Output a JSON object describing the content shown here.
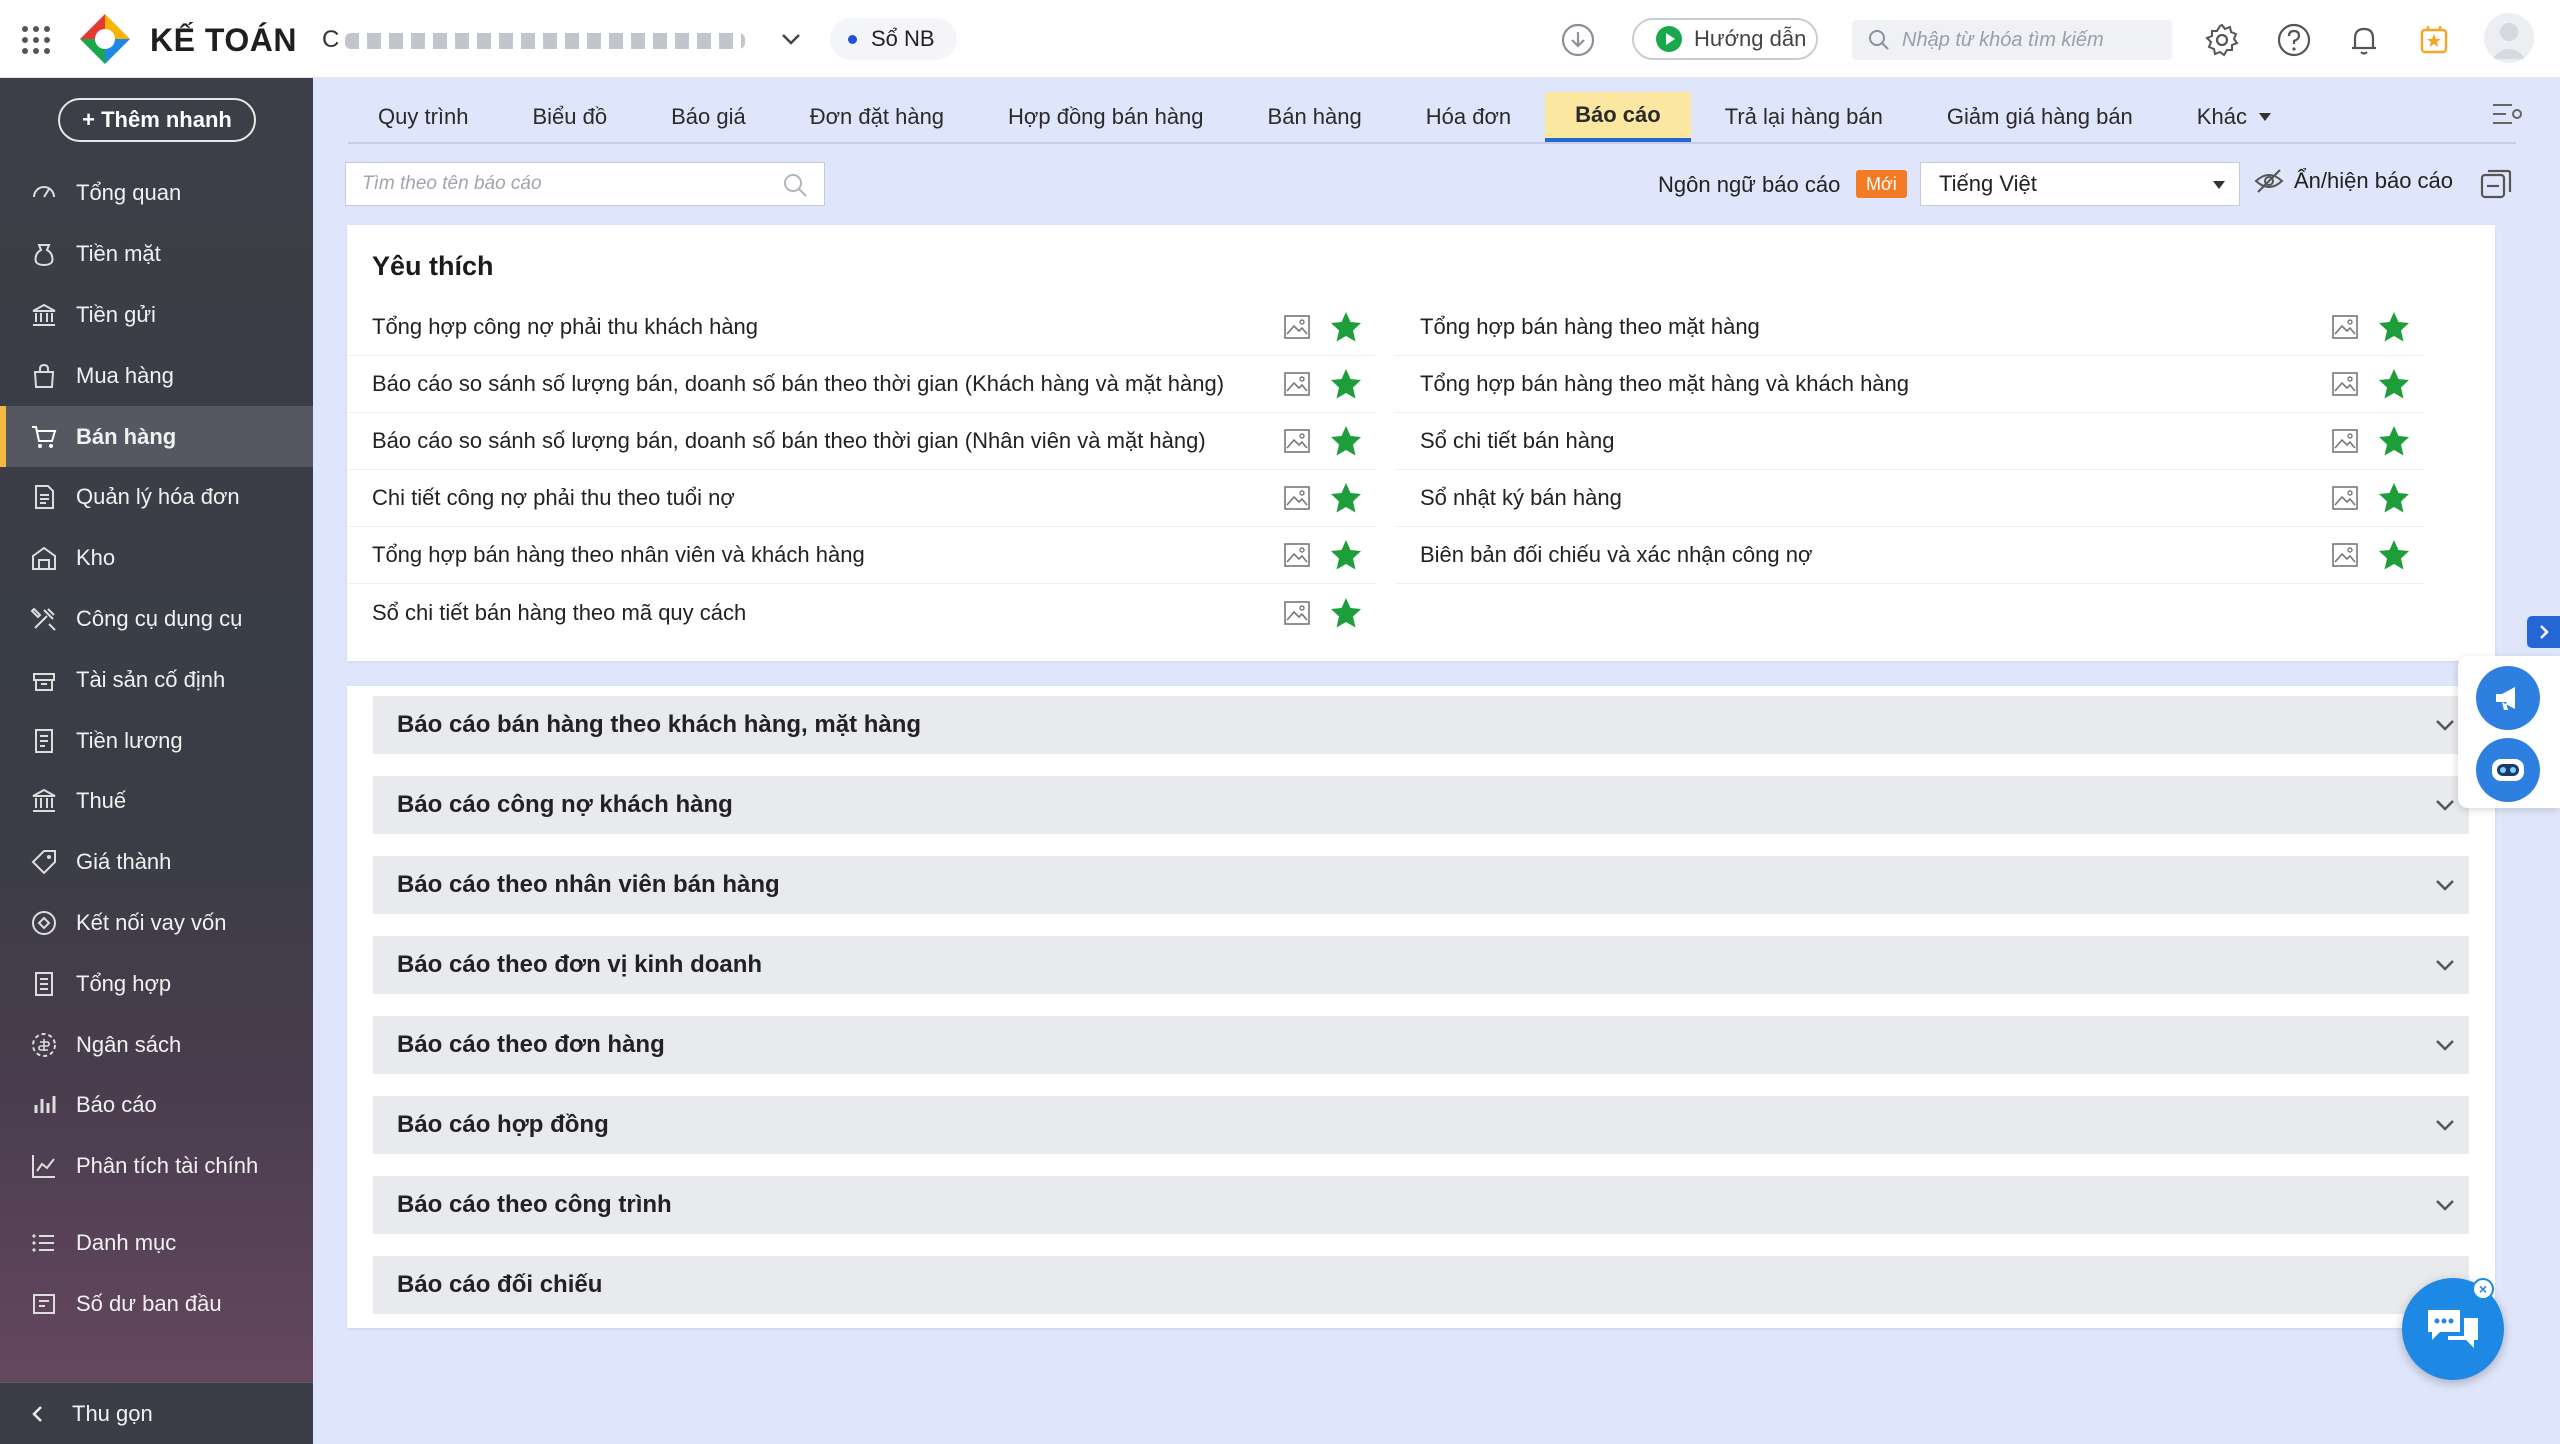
{
  "header": {
    "app_name": "KẾ TOÁN",
    "company_name": "C",
    "book_label": "Sổ NB",
    "guide_label": "Hướng dẫn",
    "search_placeholder": "Nhập từ khóa tìm kiếm"
  },
  "sidebar": {
    "quick_add_label": "+ Thêm nhanh",
    "items": [
      {
        "label": "Tổng quan",
        "icon": "dashboard-icon"
      },
      {
        "label": "Tiền mặt",
        "icon": "cash-icon"
      },
      {
        "label": "Tiền gửi",
        "icon": "bank-icon"
      },
      {
        "label": "Mua hàng",
        "icon": "shopping-bag-icon"
      },
      {
        "label": "Bán hàng",
        "icon": "cart-icon"
      },
      {
        "label": "Quản lý hóa đơn",
        "icon": "invoice-icon"
      },
      {
        "label": "Kho",
        "icon": "warehouse-icon"
      },
      {
        "label": "Công cụ dụng cụ",
        "icon": "tools-icon"
      },
      {
        "label": "Tài sản cố định",
        "icon": "asset-icon"
      },
      {
        "label": "Tiền lương",
        "icon": "salary-icon"
      },
      {
        "label": "Thuế",
        "icon": "tax-icon"
      },
      {
        "label": "Giá thành",
        "icon": "price-tag-icon"
      },
      {
        "label": "Kết nối vay vốn",
        "icon": "loan-icon"
      },
      {
        "label": "Tổng hợp",
        "icon": "summary-icon"
      },
      {
        "label": "Ngân sách",
        "icon": "budget-icon"
      },
      {
        "label": "Báo cáo",
        "icon": "report-icon"
      },
      {
        "label": "Phân tích tài chính",
        "icon": "analytics-icon"
      },
      {
        "label": "Danh mục",
        "icon": "list-icon"
      },
      {
        "label": "Số dư ban đầu",
        "icon": "opening-balance-icon"
      }
    ],
    "active_item": "Bán hàng",
    "collapse_label": "Thu gọn"
  },
  "tabs": [
    {
      "label": "Quy trình"
    },
    {
      "label": "Biểu đồ"
    },
    {
      "label": "Báo giá"
    },
    {
      "label": "Đơn đặt hàng"
    },
    {
      "label": "Hợp đồng bán hàng"
    },
    {
      "label": "Bán hàng"
    },
    {
      "label": "Hóa đơn"
    },
    {
      "label": "Báo cáo"
    },
    {
      "label": "Trả lại hàng bán"
    },
    {
      "label": "Giảm giá hàng bán"
    },
    {
      "label": "Khác"
    }
  ],
  "active_tab": "Báo cáo",
  "toolbar": {
    "report_search_placeholder": "Tìm theo tên báo cáo",
    "language_label": "Ngôn ngữ báo cáo",
    "new_badge": "Mới",
    "language_value": "Tiếng Việt",
    "toggle_reports_label": "Ẩn/hiện báo cáo"
  },
  "favorites": {
    "title": "Yêu thích",
    "left": [
      "Tổng hợp công nợ phải thu khách hàng",
      "Báo cáo so sánh số lượng bán, doanh số bán theo thời gian (Khách hàng và mặt hàng)",
      "Báo cáo so sánh số lượng bán, doanh số bán theo thời gian (Nhân viên và mặt hàng)",
      "Chi tiết công nợ phải thu theo tuổi nợ",
      "Tổng hợp bán hàng theo nhân viên và khách hàng",
      "Sổ chi tiết bán hàng theo mã quy cách"
    ],
    "right": [
      "Tổng hợp bán hàng theo mặt hàng",
      "Tổng hợp bán hàng theo mặt hàng và khách hàng",
      "Sổ chi tiết bán hàng",
      "Sổ nhật ký bán hàng",
      "Biên bản đối chiếu và xác nhận công nợ"
    ]
  },
  "report_groups": [
    "Báo cáo bán hàng theo khách hàng, mặt hàng",
    "Báo cáo công nợ khách hàng",
    "Báo cáo theo nhân viên bán hàng",
    "Báo cáo theo đơn vị kinh doanh",
    "Báo cáo theo đơn hàng",
    "Báo cáo hợp đồng",
    "Báo cáo theo công trình",
    "Báo cáo đối chiếu"
  ],
  "colors": {
    "accent_blue": "#2466d4",
    "active_tab_bg": "#fbe7a0",
    "star_green": "#1e9e3a",
    "new_badge_orange": "#f47b26",
    "sidebar_bg": "#3c3f47",
    "sidebar_active_marker": "#f5b940"
  }
}
